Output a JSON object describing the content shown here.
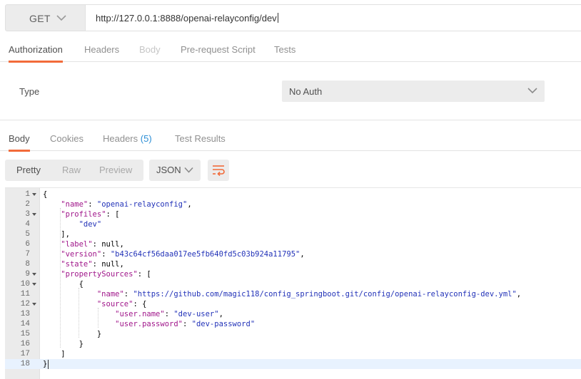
{
  "request": {
    "method": "GET",
    "url": "http://127.0.0.1:8888/openai-relayconfig/dev"
  },
  "request_tabs": [
    {
      "label": "Authorization",
      "state": "active"
    },
    {
      "label": "Headers",
      "state": "normal"
    },
    {
      "label": "Body",
      "state": "disabled"
    },
    {
      "label": "Pre-request Script",
      "state": "normal"
    },
    {
      "label": "Tests",
      "state": "normal"
    }
  ],
  "authorization": {
    "type_label": "Type",
    "type_value": "No Auth"
  },
  "response_tabs": {
    "body": "Body",
    "cookies": "Cookies",
    "headers": "Headers",
    "headers_count": "(5)",
    "test_results": "Test Results"
  },
  "view_modes": {
    "pretty": "Pretty",
    "raw": "Raw",
    "preview": "Preview",
    "format": "JSON"
  },
  "colors": {
    "accent": "#f26b3a",
    "json_key": "#a0168a",
    "json_string": "#2232b8",
    "count": "#2d8fd6"
  },
  "icons": {
    "method_dropdown": "chevron-down-icon",
    "auth_dropdown": "chevron-down-icon",
    "format_dropdown": "chevron-down-icon",
    "wrap": "wrap-lines-icon",
    "fold": "fold-caret-icon"
  },
  "code_lines": [
    {
      "n": "1",
      "fold": true,
      "text": "{"
    },
    {
      "n": "2",
      "fold": false,
      "text": "    \"name\": \"openai-relayconfig\","
    },
    {
      "n": "3",
      "fold": true,
      "text": "    \"profiles\": ["
    },
    {
      "n": "4",
      "fold": false,
      "text": "        \"dev\""
    },
    {
      "n": "5",
      "fold": false,
      "text": "    ],"
    },
    {
      "n": "6",
      "fold": false,
      "text": "    \"label\": null,"
    },
    {
      "n": "7",
      "fold": false,
      "text": "    \"version\": \"b43c64cf56daa017ee5fb640fd5c03b924a11795\","
    },
    {
      "n": "8",
      "fold": false,
      "text": "    \"state\": null,"
    },
    {
      "n": "9",
      "fold": true,
      "text": "    \"propertySources\": ["
    },
    {
      "n": "10",
      "fold": true,
      "text": "        {"
    },
    {
      "n": "11",
      "fold": false,
      "text": "            \"name\": \"https://github.com/magic118/config_springboot.git/config/openai-relayconfig-dev.yml\","
    },
    {
      "n": "12",
      "fold": true,
      "text": "            \"source\": {"
    },
    {
      "n": "13",
      "fold": false,
      "text": "                \"user.name\": \"dev-user\","
    },
    {
      "n": "14",
      "fold": false,
      "text": "                \"user.password\": \"dev-password\""
    },
    {
      "n": "15",
      "fold": false,
      "text": "            }"
    },
    {
      "n": "16",
      "fold": false,
      "text": "        }"
    },
    {
      "n": "17",
      "fold": false,
      "text": "    ]"
    },
    {
      "n": "18",
      "fold": false,
      "text": "}"
    }
  ]
}
